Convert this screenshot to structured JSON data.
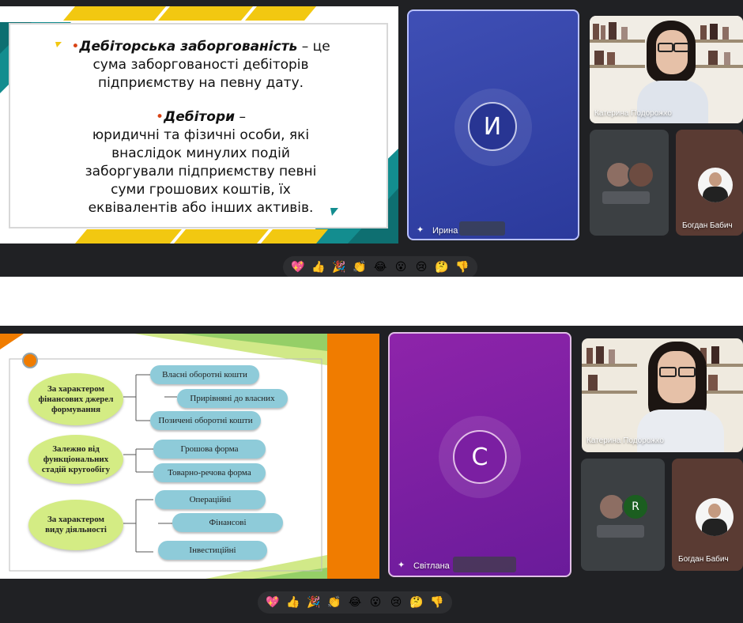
{
  "top": {
    "slide": {
      "term1": "Дебіторська заборгованість",
      "def1_a": " – це",
      "def1_b": "сума заборгованості дебіторів",
      "def1_c": "підприємству на певну дату.",
      "term2": "Дебітори",
      "def2_dash": " –",
      "def2_a": "юридичні та фізичні особи, які",
      "def2_b": "внаслідок минулих подій",
      "def2_c": "заборгували підприємству певні",
      "def2_d": "суми грошових коштів, їх",
      "def2_e": "еквівалентів  або інших активів."
    },
    "main_tile": {
      "initial": "И",
      "name": "Ирина",
      "color": "#3949ab"
    },
    "side_tiles": [
      {
        "name": "Катерина Подорожко"
      },
      {
        "name": ""
      },
      {
        "name": "Богдан Бабич"
      }
    ]
  },
  "bottom": {
    "slide": {
      "groups": [
        "За характером фінансових джерел формування",
        "Залежно від функціональних стадій кругообігу",
        "За характером виду діяльності"
      ],
      "items": [
        "Власні оборотні кошти",
        "Прирівняні до власних",
        "Позичені оборотні кошти",
        "Грошова форма",
        "Товарно-речова форма",
        "Операційні",
        "Фінансові",
        "Інвестиційні"
      ]
    },
    "main_tile": {
      "initial": "С",
      "name": "Світлана",
      "color": "#7b1fa2"
    },
    "side_tiles": [
      {
        "name": "Катерина Подорожко"
      },
      {
        "initial": "R",
        "name": ""
      },
      {
        "name": "Богдан Бабич"
      }
    ]
  },
  "reactions": [
    "💖",
    "👍",
    "🎉",
    "👏",
    "😂",
    "😮",
    "😢",
    "🤔",
    "👎"
  ],
  "icons": {
    "pin": "pin-icon",
    "accent_yellow": "#f2c811",
    "accent_teal": "#138d8f",
    "accent_orange": "#f07c00"
  }
}
